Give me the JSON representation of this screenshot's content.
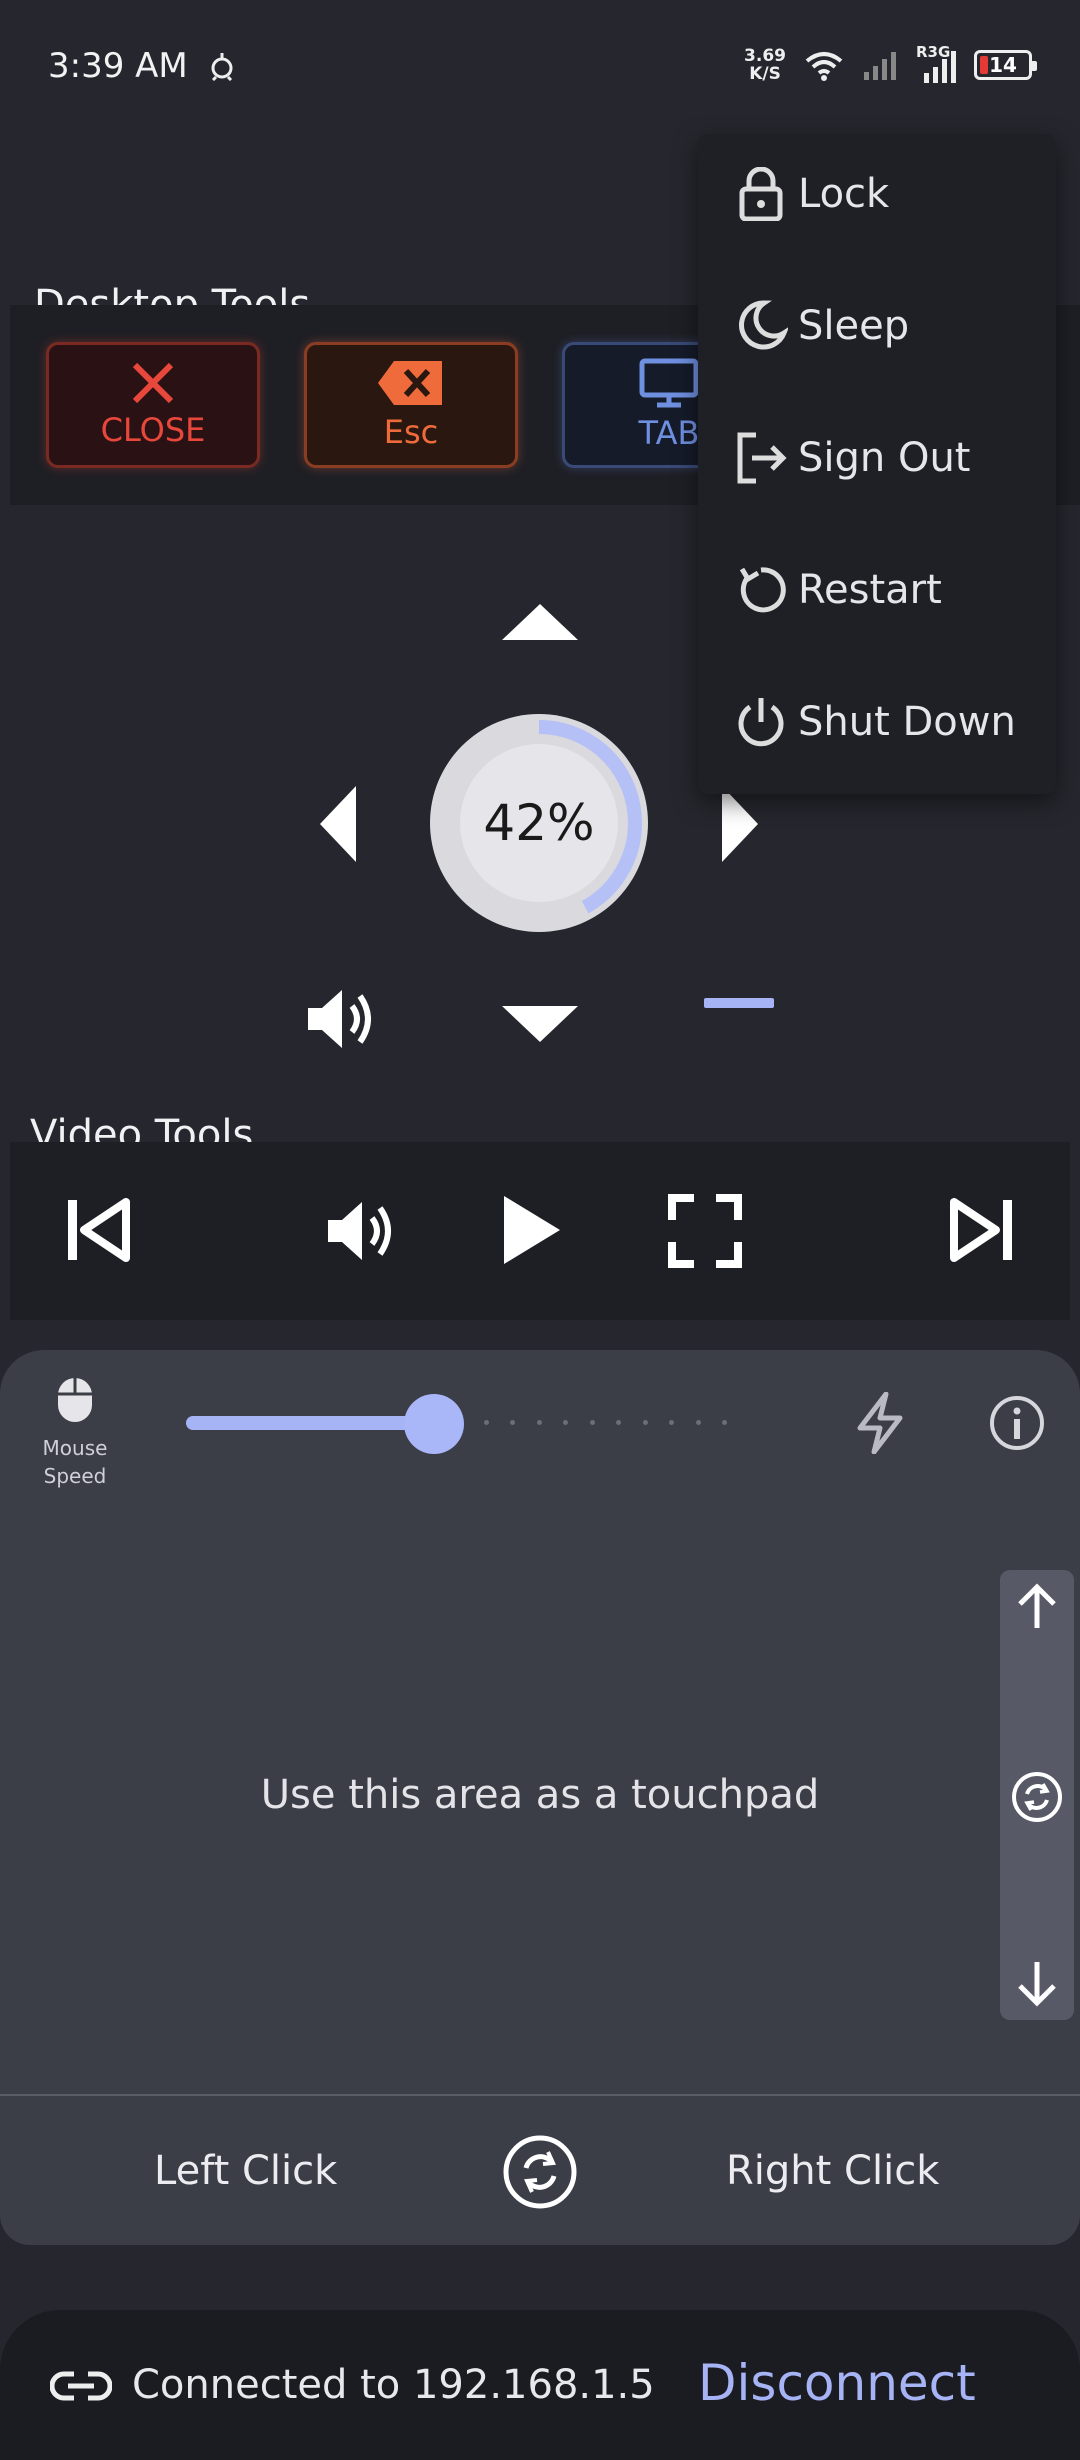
{
  "status_bar": {
    "time": "3:39 AM",
    "net_speed_value": "3.69",
    "net_speed_unit": "K/S",
    "network_label": "R3G",
    "battery": "14"
  },
  "desktop_tools": {
    "title": "Desktop Tools",
    "buttons": [
      {
        "label": "CLOSE",
        "icon": "close-x-icon"
      },
      {
        "label": "Esc",
        "icon": "backspace-icon"
      },
      {
        "label": "TAB",
        "icon": "monitor-icon"
      }
    ]
  },
  "power_menu": {
    "items": [
      {
        "label": "Lock",
        "icon": "lock-icon"
      },
      {
        "label": "Sleep",
        "icon": "moon-icon"
      },
      {
        "label": "Sign Out",
        "icon": "sign-out-icon"
      },
      {
        "label": "Restart",
        "icon": "restart-icon"
      },
      {
        "label": "Shut Down",
        "icon": "power-icon"
      }
    ]
  },
  "dpad": {
    "volume_display": "42%",
    "volume_level": 0.42
  },
  "video_tools": {
    "title": "Video Tools"
  },
  "touchpad": {
    "mouse_speed_label_1": "Mouse",
    "mouse_speed_label_2": "Speed",
    "speed_level": 0.45,
    "hint": "Use this area as a touchpad",
    "left_click": "Left Click",
    "right_click": "Right Click"
  },
  "footer": {
    "connection_text": "Connected to 192.168.1.5",
    "disconnect_label": "Disconnect"
  },
  "colors": {
    "accent": "#a6b3f5",
    "background": "#26272e",
    "close_red": "#e8473c",
    "esc_orange": "#f06b3c",
    "tab_blue": "#6f8fe0"
  }
}
